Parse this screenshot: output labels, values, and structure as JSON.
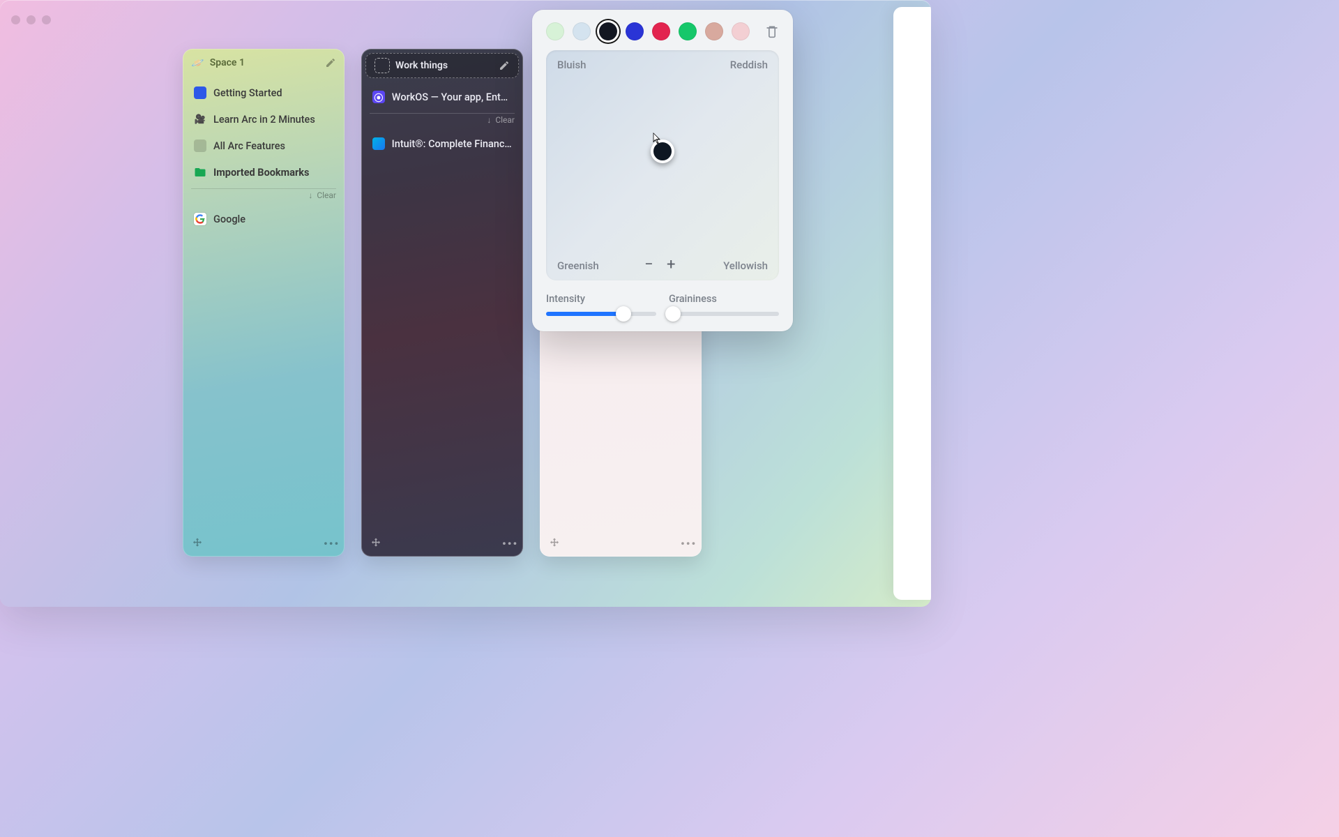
{
  "window": {
    "close_label": "✕"
  },
  "spaces": [
    {
      "title": "Space 1",
      "icon": "🪐",
      "items": [
        {
          "label": "Getting Started",
          "favicon": "blue-square"
        },
        {
          "label": "Learn Arc in 2 Minutes",
          "favicon": "camera"
        },
        {
          "label": "All Arc Features",
          "favicon": "grey-square"
        },
        {
          "label": "Imported Bookmarks",
          "favicon": "folder",
          "bold": true
        }
      ],
      "clear_label": "Clear",
      "below_items": [
        {
          "label": "Google",
          "favicon": "google"
        }
      ]
    },
    {
      "title": "Work things",
      "items": [
        {
          "label": "WorkOS — Your app, Ente…",
          "favicon": "workos"
        }
      ],
      "clear_label": "Clear",
      "below_items": [
        {
          "label": "Intuit®: Complete Financi…",
          "favicon": "intuit"
        }
      ]
    },
    {
      "title": ""
    }
  ],
  "theme_panel": {
    "swatches": [
      "#d7f2d7",
      "#d4e3ef",
      "#131722",
      "#2a34d6",
      "#e2244f",
      "#16c76a",
      "#d8a99e",
      "#f3cfd3"
    ],
    "selected_swatch_index": 2,
    "pad": {
      "bluish": "Bluish",
      "reddish": "Reddish",
      "greenish": "Greenish",
      "yellowish": "Yellowish"
    },
    "intensity_label": "Intensity",
    "graininess_label": "Graininess",
    "intensity_value": 70,
    "graininess_value": 4
  }
}
